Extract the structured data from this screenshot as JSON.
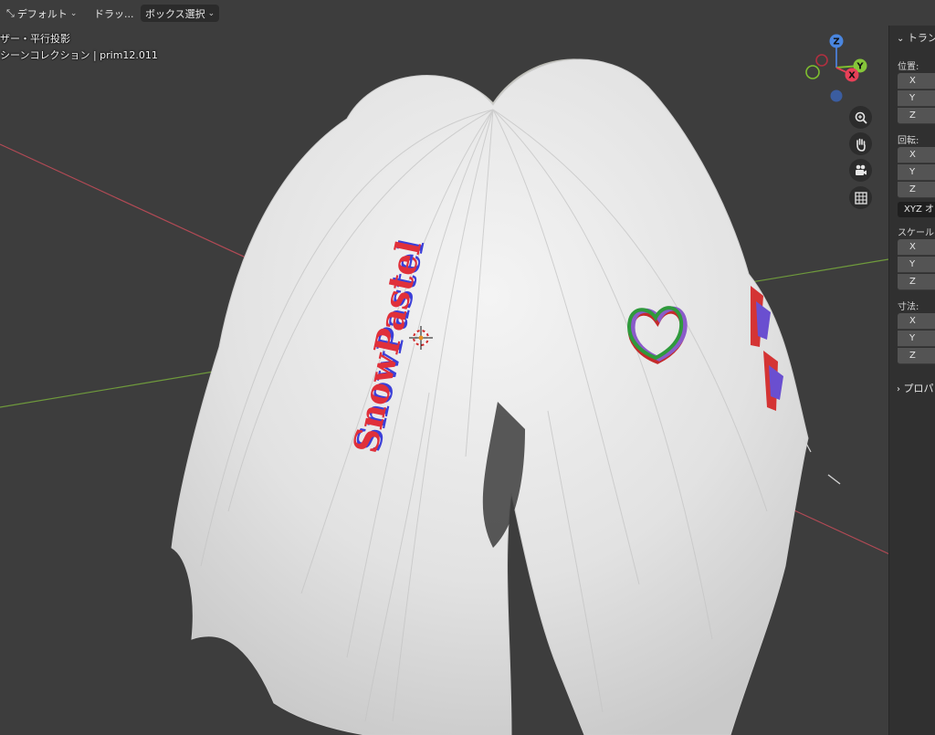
{
  "header": {
    "mode_label": "デフォルト",
    "drag_label": "ドラッ...",
    "select_label": "ボックス選択"
  },
  "viewport": {
    "view_label": "ザー・平行投影",
    "collection_label": "シーンコレクション | prim12.011",
    "decal_text": "SnowPastel"
  },
  "gizmo": {
    "z": "Z",
    "y": "Y",
    "x": "X"
  },
  "nav_buttons": [
    "zoom-icon",
    "pan-hand-icon",
    "camera-icon",
    "grid-icon"
  ],
  "npanel": {
    "header": "トラン",
    "location": {
      "label": "位置:",
      "x": "X",
      "y": "Y",
      "z": "Z"
    },
    "rotation": {
      "label": "回転:",
      "x": "X",
      "y": "Y",
      "z": "Z"
    },
    "rotation_mode": "XYZ オ",
    "scale": {
      "label": "スケール",
      "x": "X",
      "y": "Y",
      "z": "Z"
    },
    "dimensions": {
      "label": "寸法:",
      "x": "X",
      "y": "Y",
      "z": "Z"
    },
    "properties_header": "プロパ"
  },
  "colors": {
    "background": "#3d3d3d",
    "axis_x": "#c65a64",
    "axis_y": "#73a13d",
    "hair": "#e8e8e8",
    "decal_red": "#e0303a",
    "decal_blue": "#3b3fd8"
  }
}
